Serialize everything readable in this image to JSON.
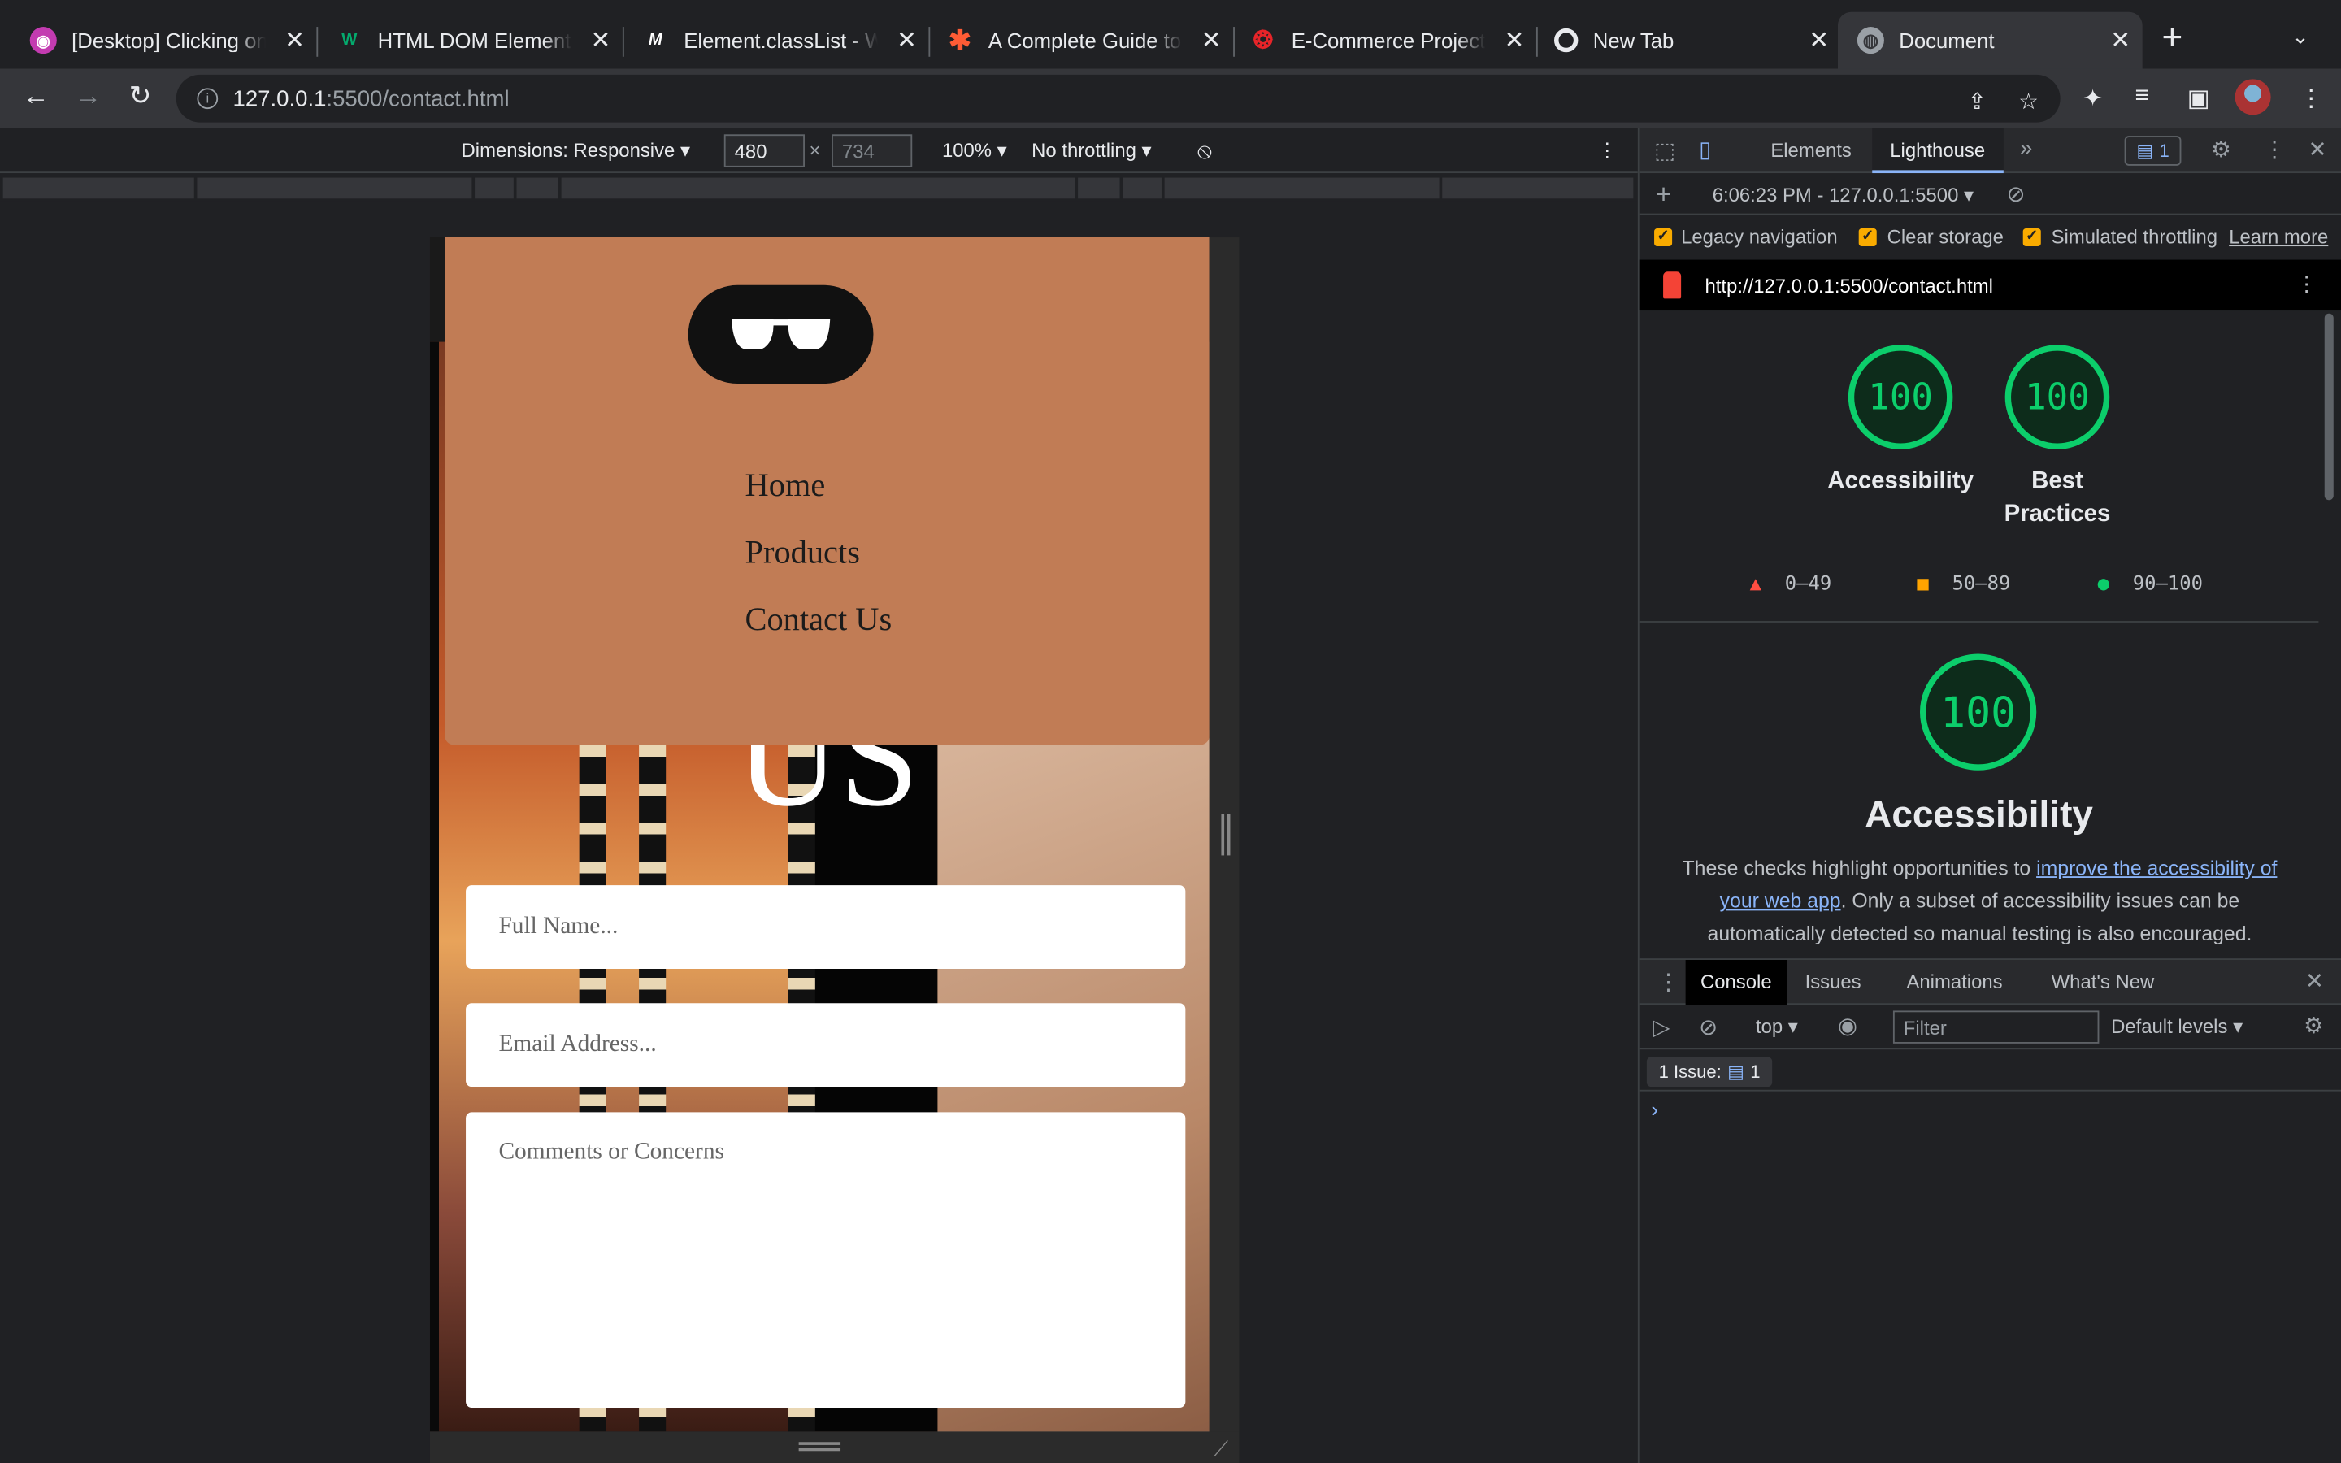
{
  "browser": {
    "tabs": [
      {
        "title": "[Desktop] Clicking on",
        "favicon": "podcast-icon",
        "color": "#c33bb0",
        "active": false
      },
      {
        "title": "HTML DOM Element a",
        "favicon": "w3schools-icon",
        "color": "#04aa6d",
        "active": false
      },
      {
        "title": "Element.classList - W",
        "favicon": "mdn-icon",
        "color": "#ffffff",
        "active": false
      },
      {
        "title": "A Complete Guide to",
        "favicon": "asterisk-icon",
        "color": "#ff5c35",
        "active": false
      },
      {
        "title": "E-Commerce Project",
        "favicon": "canvas-icon",
        "color": "#e72429",
        "active": false
      },
      {
        "title": "New Tab",
        "favicon": "chrome-icon",
        "color": "#e8eaed",
        "active": false
      },
      {
        "title": "Document",
        "favicon": "globe-icon",
        "color": "#9aa0a6",
        "active": true
      }
    ],
    "url_host": "127.0.0.1",
    "url_rest": ":5500/contact.html"
  },
  "device_toolbar": {
    "dimensions_label": "Dimensions: Responsive",
    "width": "480",
    "height": "734",
    "zoom": "100%",
    "throttling": "No throttling"
  },
  "page": {
    "nav": [
      "Home",
      "Products",
      "Contact Us"
    ],
    "heading_fragment": "US",
    "name_placeholder": "Full Name...",
    "email_placeholder": "Email Address...",
    "comments_placeholder": "Comments or Concerns"
  },
  "devtools": {
    "tabs": [
      "Elements",
      "Lighthouse"
    ],
    "active_tab": "Lighthouse",
    "issues_count": "1",
    "report_time": "6:06:23 PM - 127.0.0.1:5500",
    "options": [
      "Legacy navigation",
      "Clear storage",
      "Simulated throttling"
    ],
    "learn_more": "Learn more",
    "report_url": "http://127.0.0.1:5500/contact.html",
    "scores": [
      {
        "label": "Accessibility",
        "value": "100"
      },
      {
        "label": "Best Practices",
        "value": "100"
      }
    ],
    "legend": [
      {
        "range": "0–49",
        "color": "#ff4e42"
      },
      {
        "range": "50–89",
        "color": "#ffa400"
      },
      {
        "range": "90–100",
        "color": "#0cce6b"
      }
    ],
    "section": {
      "score": "100",
      "title": "Accessibility",
      "desc_before": "These checks highlight opportunities to ",
      "desc_link": "improve the accessibility of your web app",
      "desc_after": ". Only a subset of accessibility issues can be automatically detected so manual testing is also encouraged."
    },
    "drawer": {
      "tabs": [
        "Console",
        "Issues",
        "Animations",
        "What's New"
      ],
      "context": "top",
      "filter_placeholder": "Filter",
      "levels": "Default levels",
      "issue_label": "1 Issue:",
      "issue_count": "1"
    }
  }
}
